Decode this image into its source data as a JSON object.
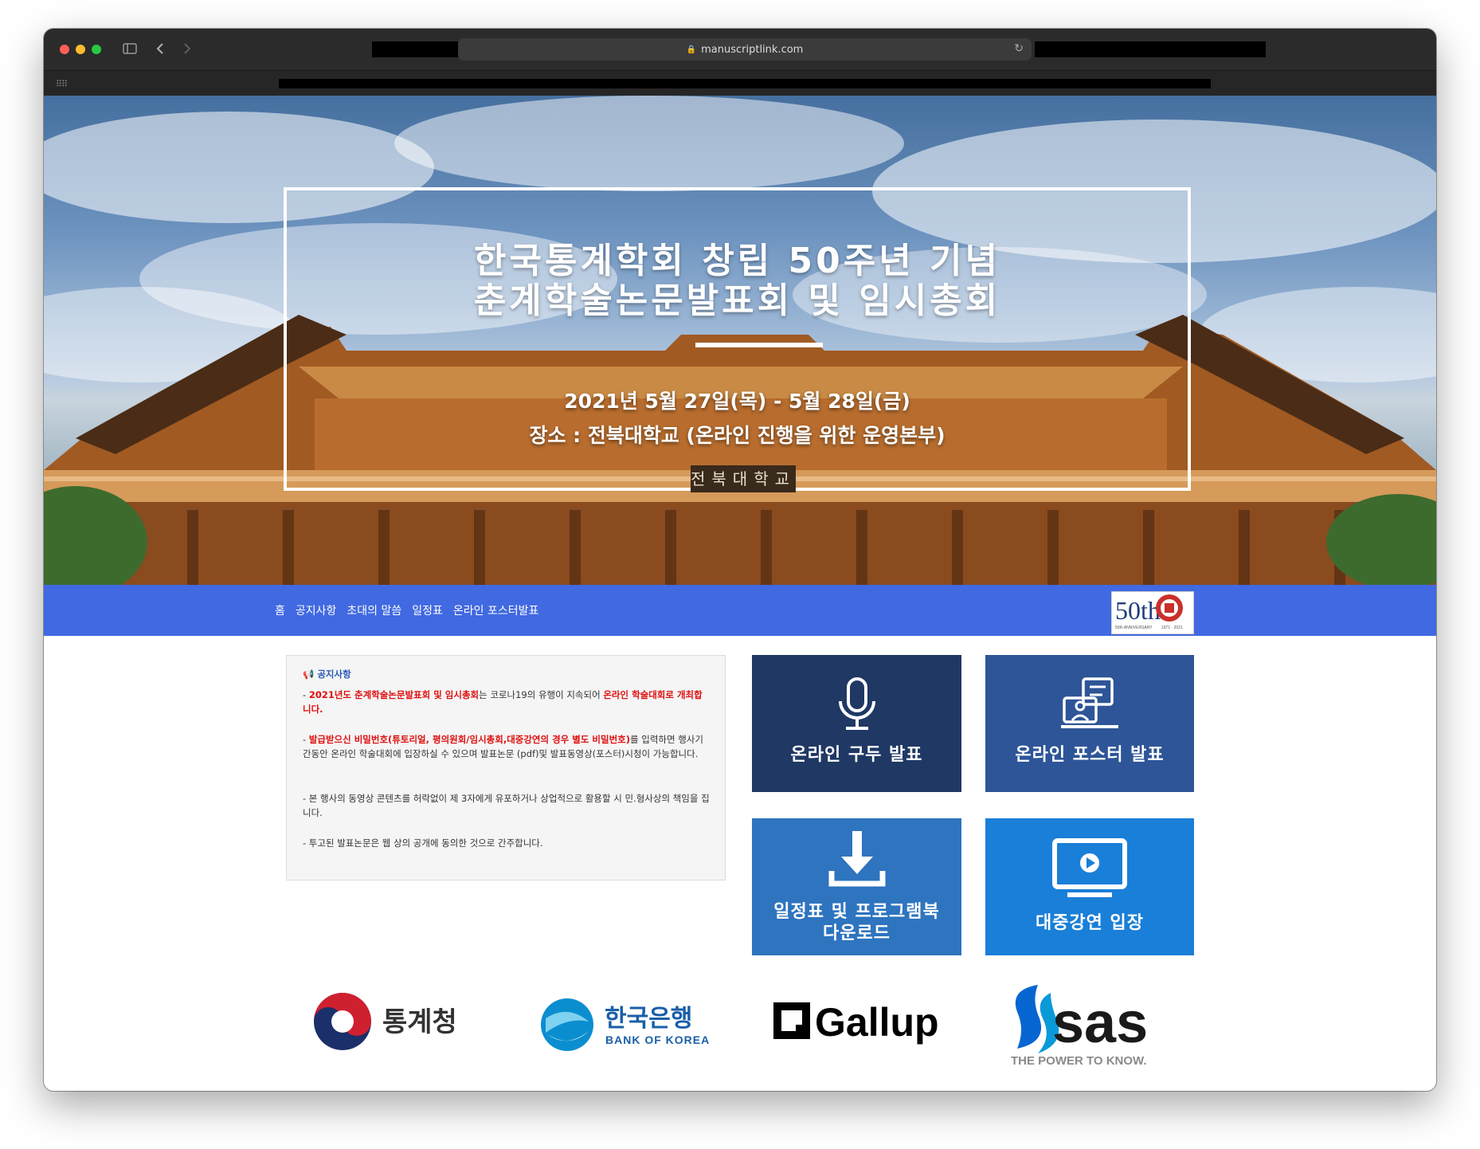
{
  "browser": {
    "url": "manuscriptlink.com"
  },
  "hero": {
    "title_line1": "한국통계학회 창립 50주년 기념",
    "title_line2": "춘계학술논문발표회 및 임시총회",
    "date": "2021년 5월 27일(목) - 5월 28일(금)",
    "place": "장소 : 전북대학교 (온라인 진행을 위한 운영본부)",
    "plaque": "전북대학교"
  },
  "nav": {
    "items": [
      {
        "label": "홈"
      },
      {
        "label": "공지사항"
      },
      {
        "label": "초대의 말씀"
      },
      {
        "label": "일정표"
      },
      {
        "label": "온라인 포스터발표"
      }
    ]
  },
  "notice": {
    "heading": "공지사항",
    "p1_prefix": "- ",
    "p1_red1": "2021년도 춘계학술논문발표회 및 임시총회",
    "p1_mid": "는 코로나19의 유행이 지속되어 ",
    "p1_red2": "온라인 학술대회로 개최합니다.",
    "p2_prefix": "- ",
    "p2_red": "발급받으신 비밀번호(튜토리얼, 평의원회/임시총회,대중강연의 경우 별도 비밀번호)",
    "p2_rest": "를 입력하면 행사기간동안 온라인 학술대회에 입장하실 수 있으며 발표논문 (pdf)및 발표동영상(포스터)시청이 가능합니다.",
    "p3": "- 본 행사의 동영상 콘텐츠를 허락없이 제 3자에게 유포하거나 상업적으로 활용할 시 민.형사상의 책임을 집니다.",
    "p4": "- 투고된 발표논문은 웹 상의 공개에 동의한 것으로 간주합니다."
  },
  "tiles": [
    {
      "label": "온라인 구두 발표",
      "icon": "microphone-icon",
      "color": "#1f3864"
    },
    {
      "label": "온라인 포스터 발표",
      "icon": "poster-presenter-icon",
      "color": "#2e5597"
    },
    {
      "label_line1": "일정표 및 프로그램북",
      "label_line2": "다운로드",
      "icon": "download-icon",
      "color": "#2e74bf"
    },
    {
      "label": "대중강연 입장",
      "icon": "monitor-play-icon",
      "color": "#1a7fd8"
    }
  ],
  "sponsors": {
    "statistics_korea": "통계청",
    "bok_korean": "한국은행",
    "bok_english": "BANK OF KOREA",
    "gallup": "Gallup",
    "sas": "sas",
    "sas_tagline": "THE POWER TO KNOW."
  },
  "anniversary_logo": {
    "number": "50th",
    "caption": "50th ANNIVERSARY",
    "years": "1971 · 2021"
  }
}
